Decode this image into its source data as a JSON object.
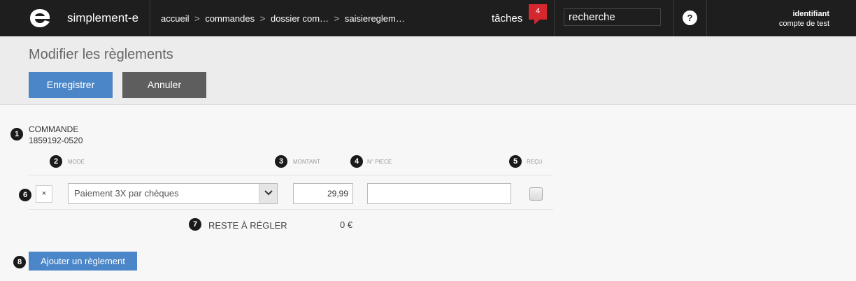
{
  "app": {
    "brand": "simplement-e"
  },
  "breadcrumb": {
    "items": [
      "accueil",
      "commandes",
      "dossier com…",
      "saisiereglem…"
    ],
    "separator": ">"
  },
  "tasks": {
    "label": "tâches",
    "count": "4"
  },
  "search": {
    "value": "recherche"
  },
  "help": {
    "glyph": "?"
  },
  "user": {
    "name": "identifiant",
    "account": "compte de test"
  },
  "page": {
    "title": "Modifier les règlements",
    "save_label": "Enregistrer",
    "cancel_label": "Annuler"
  },
  "commande": {
    "label": "COMMANDE",
    "number": "1859192-0520"
  },
  "columns": {
    "mode": "MODE",
    "montant": "MONTANT",
    "piece": "N° PIECE",
    "recu": "REÇU"
  },
  "payment_row": {
    "delete_glyph": "×",
    "mode": "Paiement 3X par chèques",
    "amount": "29,99",
    "piece": "",
    "received": false
  },
  "summary": {
    "reste_label": "RESTE À RÉGLER",
    "reste_value": "0 €"
  },
  "add_label": "Ajouter un règlement",
  "markers": [
    "1",
    "2",
    "3",
    "4",
    "5",
    "6",
    "7",
    "8"
  ],
  "colors": {
    "primary": "#4a86c8",
    "topbar": "#1e1e1e",
    "badge": "#d6272f",
    "cancel": "#5e5e5e"
  }
}
